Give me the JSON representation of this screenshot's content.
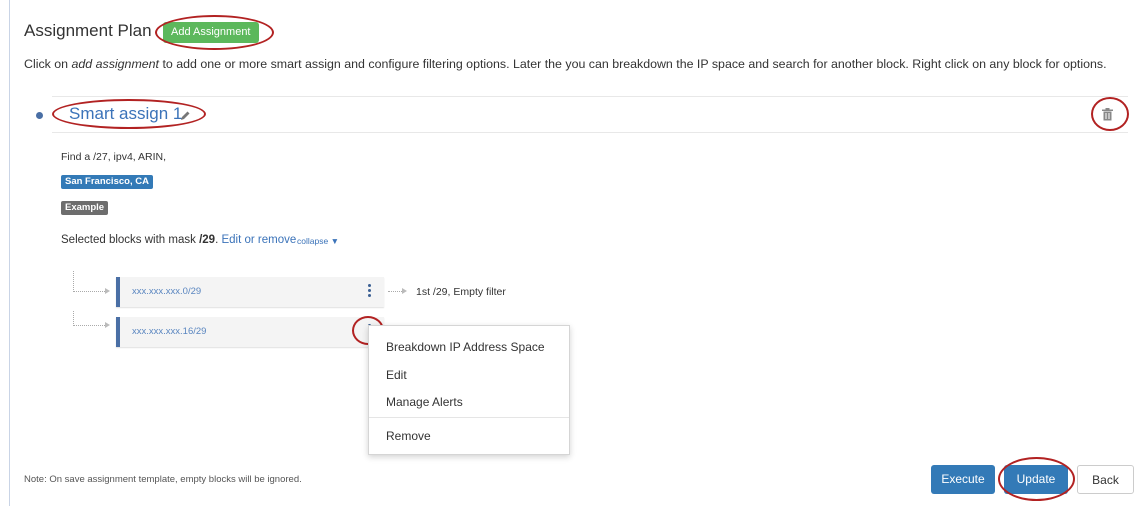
{
  "header": {
    "title": "Assignment Plan",
    "add_button": "Add Assignment"
  },
  "instructions": {
    "prefix": "Click on ",
    "emphasis": "add assignment",
    "suffix": " to add one or more smart assign and configure filtering options. Later the you can breakdown the IP space and search for another block. Right click on any block for options."
  },
  "panel": {
    "title": "Smart assign 1",
    "filter_desc": "Find a /27, ipv4, ARIN,",
    "location_label": "San Francisco, CA",
    "example_label": "Example",
    "selected_prefix": "Selected blocks with mask ",
    "selected_mask": "/29",
    "selected_dot": ".",
    "edit_link": "Edit or remove",
    "collapse_link": "collapse"
  },
  "blocks": [
    {
      "address": "xxx.xxx.xxx.0/29",
      "description": "1st /29,   Empty filter"
    },
    {
      "address": "xxx.xxx.xxx.16/29",
      "description": ""
    }
  ],
  "context_menu": {
    "items": [
      "Breakdown IP Address Space",
      "Edit",
      "Manage Alerts",
      "Remove"
    ]
  },
  "footer": {
    "note": "Note: On save assignment template, empty blocks will be ignored.",
    "execute": "Execute",
    "update": "Update",
    "back": "Back"
  },
  "colors": {
    "primary": "#337ab7",
    "success": "#5cb85c",
    "annotation": "#b22222",
    "example": "#6d6d6d"
  }
}
